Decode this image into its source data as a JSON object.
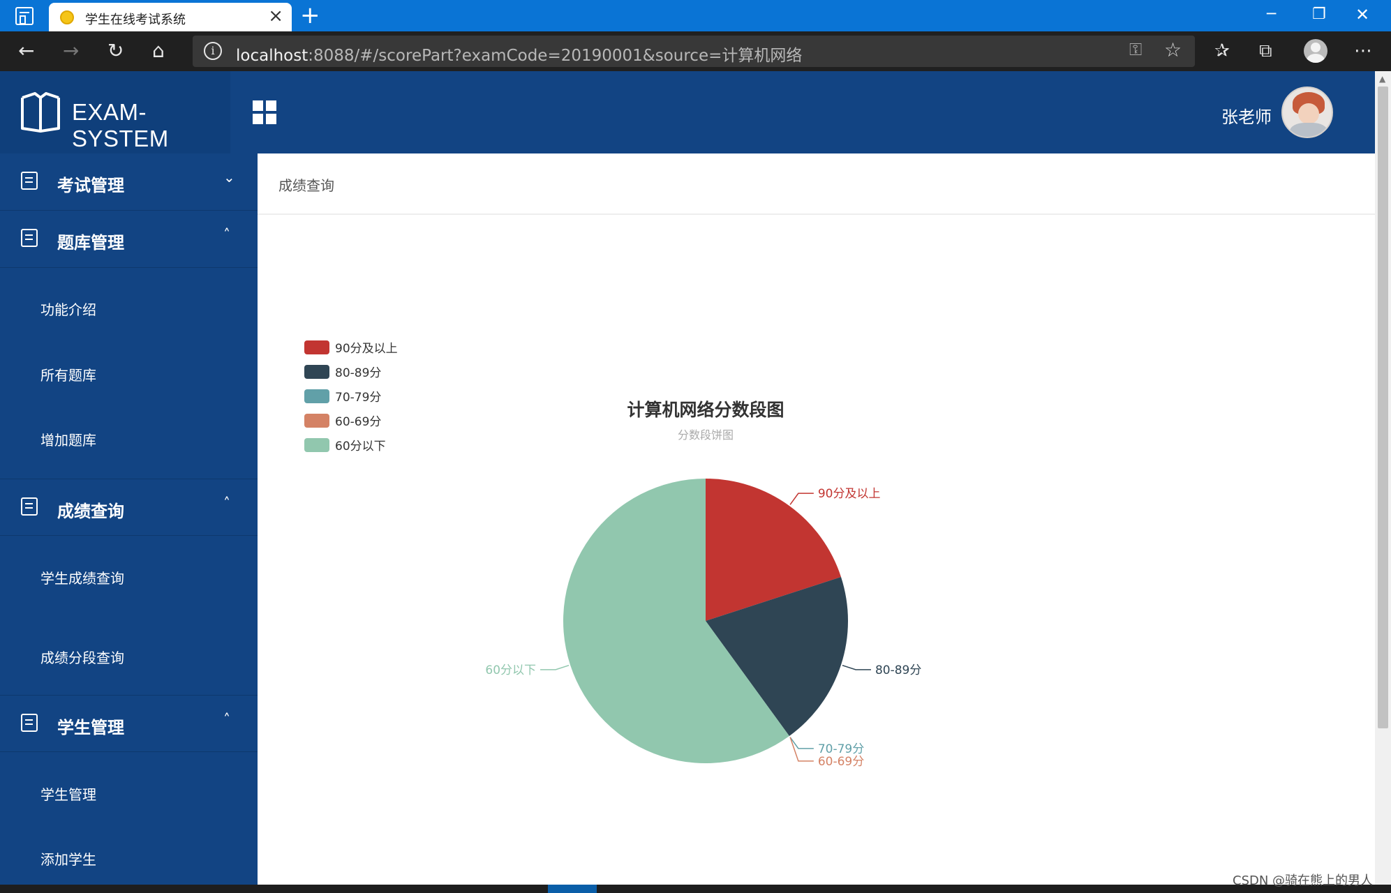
{
  "browser": {
    "tab_title": "学生在线考试系统",
    "url_host": "localhost",
    "url_rest": ":8088/#/scorePart?examCode=20190001&source=计算机网络"
  },
  "header": {
    "logo_text": "EXAM-SYSTEM",
    "user_name": "张老师"
  },
  "sidebar": {
    "groups": [
      {
        "label": "考试管理",
        "icon": "calendar-icon",
        "expanded": false,
        "items": []
      },
      {
        "label": "题库管理",
        "icon": "document-edit-icon",
        "expanded": true,
        "items": [
          "功能介绍",
          "所有题库",
          "增加题库"
        ]
      },
      {
        "label": "成绩查询",
        "icon": "keyboard-icon",
        "expanded": true,
        "items": [
          "学生成绩查询",
          "成绩分段查询"
        ]
      },
      {
        "label": "学生管理",
        "icon": "user-icon",
        "expanded": true,
        "items": [
          "学生管理",
          "添加学生"
        ]
      }
    ]
  },
  "content": {
    "breadcrumb": "成绩查询"
  },
  "chart_data": {
    "type": "pie",
    "title": "计算机网络分数段图",
    "subtitle": "分数段饼图",
    "legend_position": "top-left",
    "slices": [
      {
        "label": "90分及以上",
        "value": 1,
        "color": "#c23531"
      },
      {
        "label": "80-89分",
        "value": 1,
        "color": "#2f4554"
      },
      {
        "label": "70-79分",
        "value": 0,
        "color": "#61a0a8"
      },
      {
        "label": "60-69分",
        "value": 0,
        "color": "#d48265"
      },
      {
        "label": "60分以下",
        "value": 3,
        "color": "#91c7ae"
      }
    ]
  },
  "watermark": "CSDN @骑在熊上的男人"
}
